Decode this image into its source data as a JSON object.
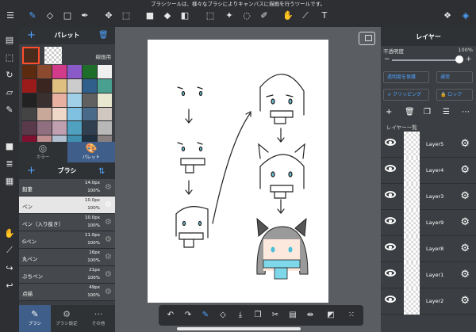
{
  "notice": "ブラシツールは、様々なブラシによりキャンバスに描画を行うツールです。",
  "top_tools": [
    "≡",
    "brush",
    "eraser",
    "rect",
    "pen",
    "move",
    "transform",
    "fill-color",
    "bucket",
    "gradient",
    "select",
    "magic-wand",
    "lasso",
    "pen-select",
    "T",
    "materials",
    "layers"
  ],
  "palette": {
    "title": "パレット",
    "line_label": "線画用",
    "colors": [
      "#5b2a0f",
      "#8b4a2f",
      "#d23a8a",
      "#8a5ac8",
      "#1f6d2a",
      "#f0f0f0",
      "#9b1a1a",
      "#3a2520",
      "#e0c080",
      "#ccc",
      "#2f5f8a",
      "#4aa090",
      "#222222",
      "#3b3030",
      "#e8b0a0",
      "#a0d0e8",
      "#606060",
      "#e8e8d0",
      "#444",
      "#c8a898",
      "#f0d8c8",
      "#80c0e0",
      "#4a6a8a",
      "#d0c8c0",
      "#5a3a4a",
      "#907080",
      "#c0a0b0",
      "#50a0c0",
      "#304050",
      "#b8b8b8",
      "#801030",
      "#c09090",
      "#b0c0d0",
      "#4090b0",
      "#203040",
      "#888080",
      "#303840",
      "#606878",
      "#f0c0c8",
      "#a8d8e8",
      "#2a5a70",
      "#f8f0e0"
    ]
  },
  "color_tabs": [
    {
      "label": "カラー"
    },
    {
      "label": "パレット"
    }
  ],
  "brush": {
    "title": "ブラシ",
    "items": [
      {
        "name": "鉛筆",
        "size": "14.0px",
        "opacity": "100%"
      },
      {
        "name": "ペン",
        "size": "10.0px",
        "opacity": "100%"
      },
      {
        "name": "ペン（入り抜き）",
        "size": "10.0px",
        "opacity": "100%"
      },
      {
        "name": "Gペン",
        "size": "11.0px",
        "opacity": "100%"
      },
      {
        "name": "丸ペン",
        "size": "16px",
        "opacity": "100%"
      },
      {
        "name": "ぶちペン",
        "size": "21px",
        "opacity": "100%"
      },
      {
        "name": "点描",
        "size": "49px",
        "opacity": "100%"
      }
    ],
    "selected_index": 1
  },
  "bottom_tabs": [
    {
      "label": "ブラシ"
    },
    {
      "label": "ブラシ設定"
    },
    {
      "label": "その他"
    }
  ],
  "layers": {
    "title": "レイヤー",
    "opacity_label": "不透明度",
    "opacity_value": "100%",
    "opacity_fraction": 1.0,
    "protect_label": "透明度を保護",
    "blend_label": "通常",
    "clipping_label": "クリッピング",
    "lock_label": "ロック",
    "list_label": "レイヤー一覧",
    "items": [
      "Layer5",
      "Layer4",
      "Layer3",
      "Layer9",
      "Layer8",
      "Layer1",
      "Layer2"
    ]
  }
}
